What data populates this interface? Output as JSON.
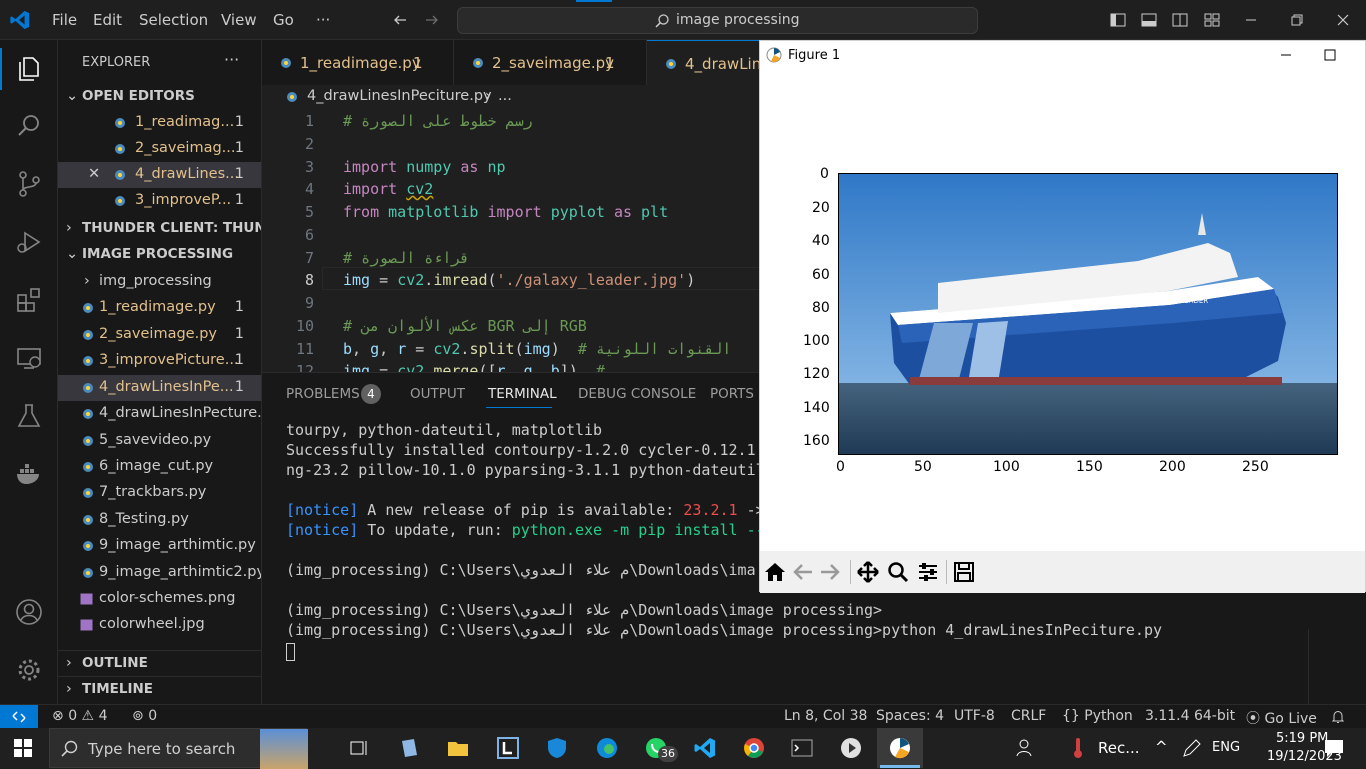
{
  "titlebar": {
    "menu": [
      "File",
      "Edit",
      "Selection",
      "View",
      "Go",
      "···"
    ],
    "search_text": "image processing"
  },
  "sidebar": {
    "explorer_label": "EXPLORER",
    "open_editors_label": "OPEN EDITORS",
    "open_editors": [
      {
        "name": "1_readimag...",
        "badge": "1"
      },
      {
        "name": "2_saveimag...",
        "badge": "1"
      },
      {
        "name": "4_drawLines...",
        "badge": "1"
      },
      {
        "name": "3_improveP...",
        "badge": "1"
      }
    ],
    "thunder_label": "THUNDER CLIENT: THUND...",
    "folder_label": "IMAGE PROCESSING",
    "files": [
      {
        "name": "img_processing",
        "badge": ""
      },
      {
        "name": "1_readimage.py",
        "badge": "1"
      },
      {
        "name": "2_saveimage.py",
        "badge": "1"
      },
      {
        "name": "3_improvePicture...",
        "badge": "1"
      },
      {
        "name": "4_drawLinesInPe...",
        "badge": "1"
      },
      {
        "name": "4_drawLinesInPecture...",
        "badge": ""
      },
      {
        "name": "5_savevideo.py",
        "badge": ""
      },
      {
        "name": "6_image_cut.py",
        "badge": ""
      },
      {
        "name": "7_trackbars.py",
        "badge": ""
      },
      {
        "name": "8_Testing.py",
        "badge": ""
      },
      {
        "name": "9_image_arthimtic.py",
        "badge": ""
      },
      {
        "name": "9_image_arthimtic2.py",
        "badge": ""
      },
      {
        "name": "color-schemes.png",
        "badge": ""
      },
      {
        "name": "colorwheel.jpg",
        "badge": ""
      }
    ],
    "outline_label": "OUTLINE",
    "timeline_label": "TIMELINE"
  },
  "tabs": [
    {
      "label": "1_readimage.py",
      "badge": "1"
    },
    {
      "label": "2_saveimage.py",
      "badge": "1"
    },
    {
      "label": "4_drawLine"
    }
  ],
  "breadcrumb": {
    "file": "4_drawLinesInPeciture.py",
    "more": "..."
  },
  "code": {
    "line_numbers": [
      "1",
      "2",
      "3",
      "4",
      "5",
      "6",
      "7",
      "8",
      "9",
      "10",
      "11",
      "12"
    ],
    "lines": [
      "# رسم خطوط على الصورة",
      "",
      "import numpy as np",
      "import cv2",
      "from matplotlib import pyplot as plt",
      "",
      "# قراءة الصورة",
      "img = cv2.imread('./galaxy_leader.jpg')",
      "",
      "# عكس الألوان من BGR إلى RGB",
      "b, g, r = cv2.split(img)  # القنوات اللونية",
      "img = cv2.merge([r, g, b])  #"
    ]
  },
  "panel": {
    "tabs": [
      "PROBLEMS",
      "OUTPUT",
      "TERMINAL",
      "DEBUG CONSOLE",
      "PORTS"
    ],
    "problems_count": "4",
    "terminal": [
      "tourpy, python-dateutil, matplotlib",
      "Successfully installed contourpy-1.2.0 cycler-0.12.1",
      "ng-23.2 pillow-10.1.0 pyparsing-3.1.1 python-dateutil",
      "",
      "[notice] A new release of pip is available: 23.2.1 ->",
      "[notice] To update, run: python.exe -m pip install --",
      "",
      "(img_processing) C:\\Users\\م علاء العدوي\\Downloads\\ima",
      "",
      "(img_processing) C:\\Users\\م علاء العدوي\\Downloads\\image processing>",
      "(img_processing) C:\\Users\\م علاء العدوي\\Downloads\\image processing>python 4_drawLinesInPeciture.py"
    ],
    "notice": "[notice]",
    "notice_line1_a": " A new release of pip is available: ",
    "notice_line1_b": "23.2.1",
    "notice_line1_c": " ->",
    "notice_line2_a": " To update, run: ",
    "notice_line2_b": "python.exe -m pip install --"
  },
  "figure": {
    "title": "Figure 1",
    "y_ticks": [
      "0",
      "20",
      "40",
      "60",
      "80",
      "100",
      "120",
      "140",
      "160"
    ],
    "x_ticks": [
      "0",
      "50",
      "100",
      "150",
      "200",
      "250"
    ],
    "ship_label": "GALAXY LEADER"
  },
  "status": {
    "errors": "0",
    "warnings": "4",
    "ports": "0",
    "position": "Ln 8, Col 38",
    "spaces": "Spaces: 4",
    "encoding": "UTF-8",
    "eol": "CRLF",
    "language": "Python",
    "interpreter": "3.11.4 64-bit",
    "golive": "Go Live"
  },
  "taskbar": {
    "search_placeholder": "Type here to search",
    "whatsapp_badge": "36",
    "recording": "Rec...",
    "lang": "ENG",
    "time": "5:19 PM",
    "date": "19/12/2023"
  }
}
